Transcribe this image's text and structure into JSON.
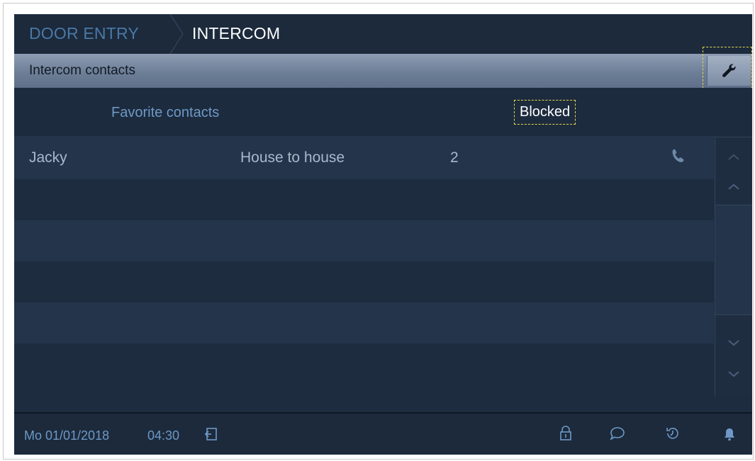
{
  "header": {
    "crumb_parent": "DOOR ENTRY",
    "crumb_current": "INTERCOM"
  },
  "titlebar": {
    "title": "Intercom contacts",
    "settings_icon": "wrench-icon"
  },
  "tabs": [
    {
      "label": "Favorite contacts",
      "selected": false
    },
    {
      "label": "Blocked",
      "selected": true
    }
  ],
  "contacts": [
    {
      "name": "Jacky",
      "type": "House to house",
      "number": "2",
      "icon": "phone-icon"
    }
  ],
  "scrollbar": {
    "up_icons": [
      "chevron-up-icon",
      "chevron-up-icon"
    ],
    "down_icons": [
      "chevron-down-icon",
      "chevron-down-icon"
    ]
  },
  "footer": {
    "date": "Mo 01/01/2018",
    "time": "04:30",
    "icons": [
      "exit-icon",
      "lock-icon",
      "message-icon",
      "history-icon",
      "bell-icon"
    ]
  },
  "colors": {
    "accent_blue": "#6e99c6",
    "focus_outline": "#e6d84a",
    "background": "#1e2c3f"
  }
}
